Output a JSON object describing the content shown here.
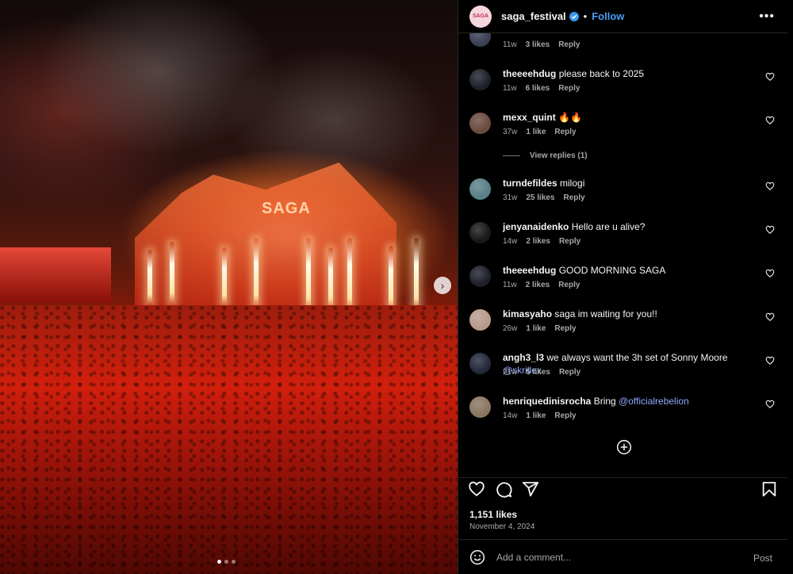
{
  "header": {
    "username": "saga_festival",
    "separator": "•",
    "follow_label": "Follow",
    "more_label": "•••",
    "avatar_text": "SAGA"
  },
  "media": {
    "stage_logo": "SAGA",
    "next_icon": "›",
    "dot_count": 3
  },
  "comments": [
    {
      "username": "",
      "text": "",
      "time": "11w",
      "likes": "3 likes",
      "reply": "Reply",
      "avatar_color": "#3a3f55"
    },
    {
      "username": "theeeehdug",
      "text": "please back to 2025",
      "time": "11w",
      "likes": "6 likes",
      "reply": "Reply",
      "avatar_color": "#1d1f2a"
    },
    {
      "username": "mexx_quint",
      "text": "🔥🔥",
      "time": "37w",
      "likes": "1 like",
      "reply": "Reply",
      "avatar_color": "#6b4b40"
    },
    {
      "username": "turndefildes",
      "text": "milogi",
      "time": "31w",
      "likes": "25 likes",
      "reply": "Reply",
      "avatar_color": "#5a8088"
    },
    {
      "username": "jenyanaidenko",
      "text": "Hello are u alive?",
      "time": "14w",
      "likes": "2 likes",
      "reply": "Reply",
      "avatar_color": "#181818"
    },
    {
      "username": "theeeehdug",
      "text": "GOOD MORNING SAGA",
      "time": "11w",
      "likes": "2 likes",
      "reply": "Reply",
      "avatar_color": "#1d1f2a"
    },
    {
      "username": "kimasyaho",
      "text": "saga im waiting for you!!",
      "time": "26w",
      "likes": "1 like",
      "reply": "Reply",
      "avatar_color": "#b89a8c"
    },
    {
      "username": "angh3_l3",
      "text": "we always want the 3h set of Sonny Moore",
      "mention": "@skrillex",
      "time": "21w",
      "likes": "5 likes",
      "reply": "Reply",
      "avatar_color": "#23293a"
    },
    {
      "username": "henriquedinisrocha",
      "text": "Bring",
      "mention": "@officialrebelion",
      "time": "14w",
      "likes": "1 like",
      "reply": "Reply",
      "avatar_color": "#8a7560"
    }
  ],
  "view_replies": "View replies (1)",
  "post": {
    "likes": "1,151 likes",
    "date": "November 4, 2024"
  },
  "add_comment": {
    "placeholder": "Add a comment...",
    "post_label": "Post"
  },
  "colors": {
    "accent": "#4a9af5",
    "mention": "#8ea9ff",
    "background": "#000000",
    "muted": "#a8a8a8"
  }
}
